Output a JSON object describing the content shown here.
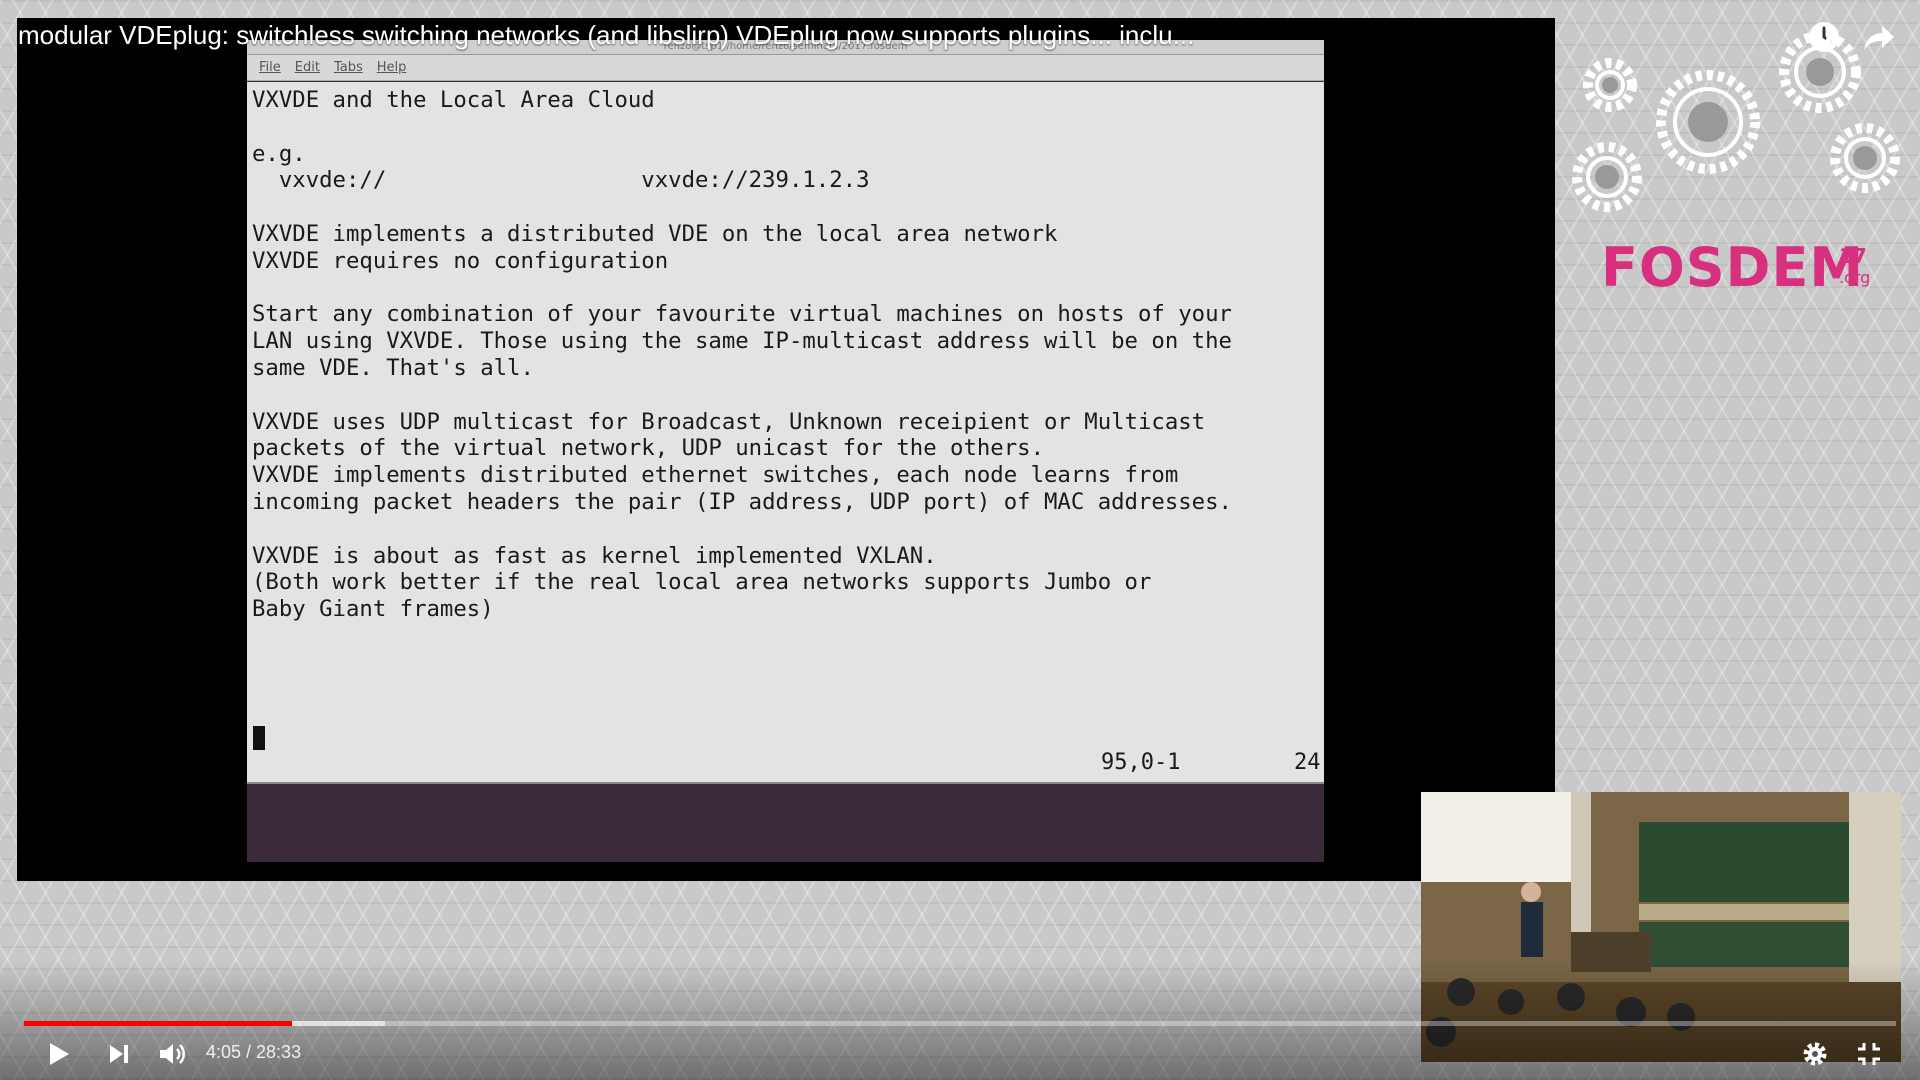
{
  "video": {
    "title": "modular VDEplug: switchless switching networks (and libslirp) VDEplug now supports plugins... inclu...",
    "current_time": "4:05",
    "duration": "28:33",
    "time_display": "4:05 / 28:33",
    "progress_played_fraction": 0.143,
    "progress_buffered_fraction": 0.193
  },
  "terminal": {
    "title": "renzo@tsp1 /home/renzo/seminars/2017.fosdem",
    "menu": [
      "File",
      "Edit",
      "Tabs",
      "Help"
    ],
    "lines": [
      "VXVDE and the Local Area Cloud",
      "",
      "e.g.",
      "  vxvde://                   vxvde://239.1.2.3",
      "",
      "VXVDE implements a distributed VDE on the local area network",
      "VXVDE requires no configuration",
      "",
      "Start any combination of your favourite virtual machines on hosts of your",
      "LAN using VXVDE. Those using the same IP-multicast address will be on the",
      "same VDE. That's all.",
      "",
      "VXVDE uses UDP multicast for Broadcast, Unknown receipient or Multicast",
      "packets of the virtual network, UDP unicast for the others.",
      "VXVDE implements distributed ethernet switches, each node learns from",
      "incoming packet headers the pair (IP address, UDP port) of MAC addresses.",
      "",
      "VXVDE is about as fast as kernel implemented VXLAN.",
      "(Both work better if the real local area networks supports Jumbo or",
      "Baby Giant frames)"
    ],
    "status_position": "95,0-1",
    "status_percent": "24"
  },
  "branding": {
    "logo_text": "FOSDEM",
    "year": "17",
    "org": ".org",
    "accent_color": "#d6307f"
  },
  "controls": {
    "play": "play-icon",
    "next": "skip-next-icon",
    "volume": "volume-icon",
    "settings": "gear-icon",
    "exit_fullscreen": "exit-fullscreen-icon",
    "watch_later": "clock-icon",
    "share": "share-icon",
    "progress_color": "#ff0000"
  }
}
